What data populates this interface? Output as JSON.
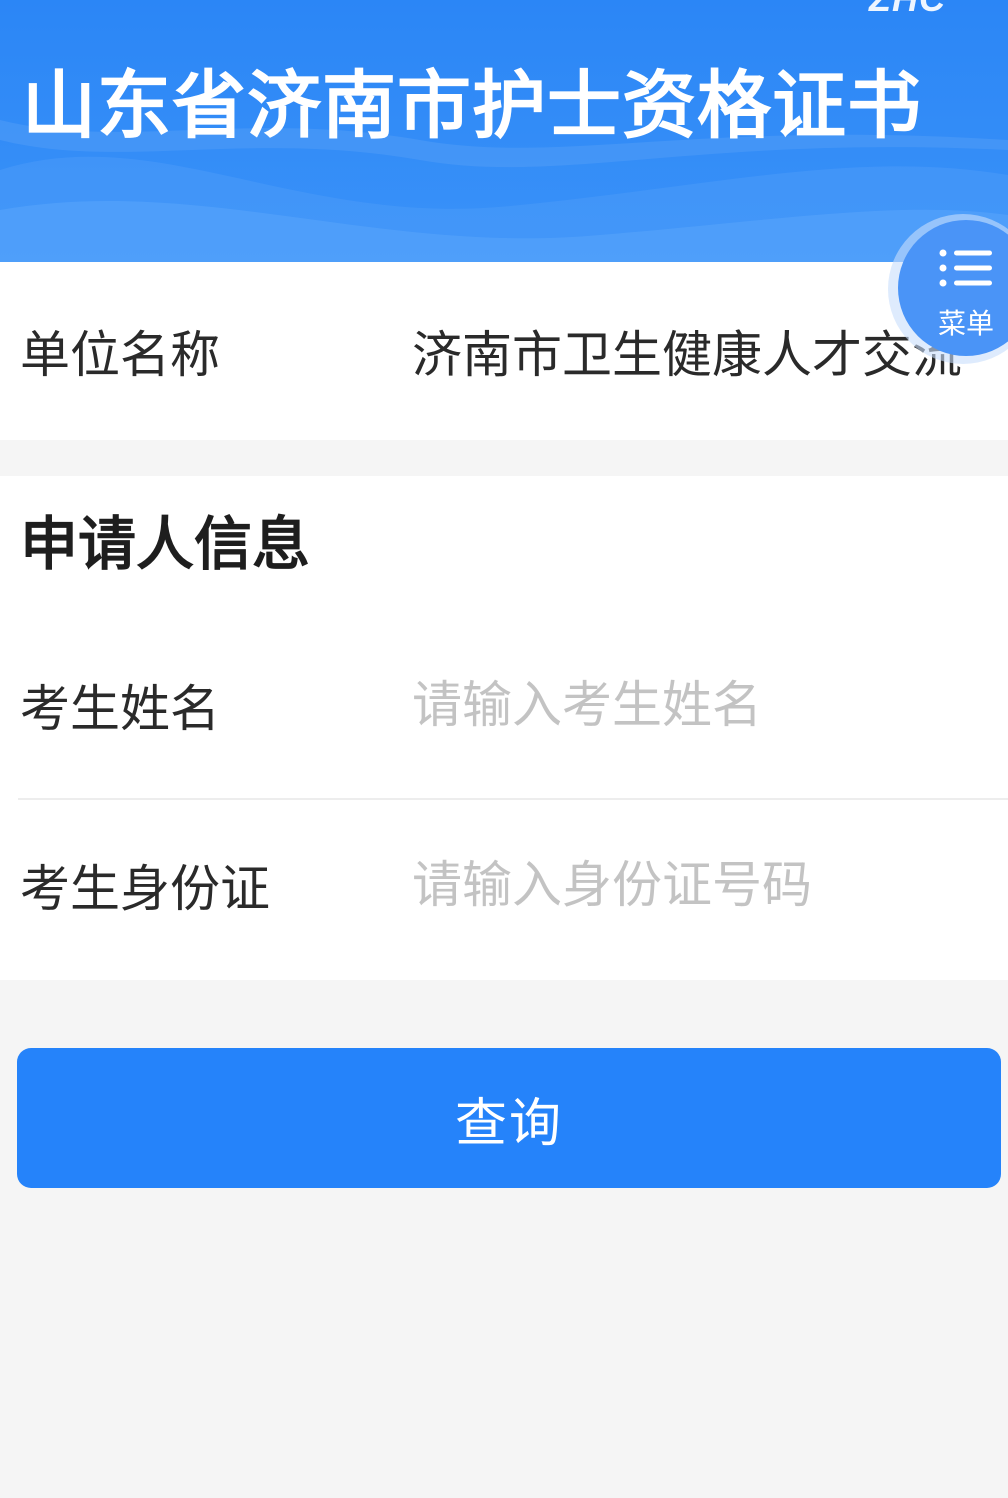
{
  "header": {
    "logo_text": "ZHC",
    "title": "山东省济南市护士资格证书"
  },
  "unit": {
    "label": "单位名称",
    "value": "济南市卫生健康人才交流"
  },
  "applicant": {
    "section_title": "申请人信息",
    "name": {
      "label": "考生姓名",
      "value": "",
      "placeholder": "请输入考生姓名"
    },
    "id": {
      "label": "考生身份证",
      "value": "",
      "placeholder": "请输入身份证号码"
    }
  },
  "query_button": {
    "label": "查询"
  },
  "menu": {
    "icon": "list-icon",
    "label": "菜单"
  },
  "colors": {
    "header_blue": "#2b86f6",
    "button_blue": "#2583fa",
    "page_bg": "#f5f5f5",
    "placeholder_gray": "#c3c3c3"
  }
}
